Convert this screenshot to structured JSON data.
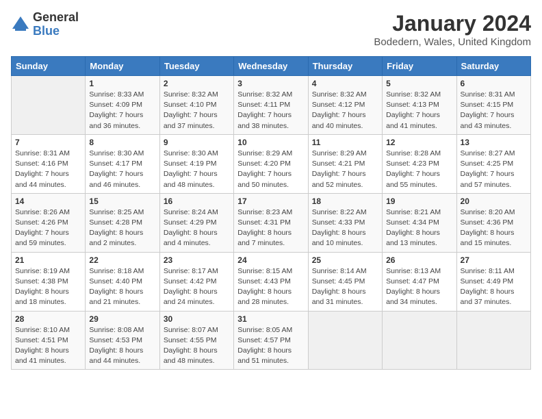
{
  "header": {
    "logo_general": "General",
    "logo_blue": "Blue",
    "month_title": "January 2024",
    "location": "Bodedern, Wales, United Kingdom"
  },
  "days_of_week": [
    "Sunday",
    "Monday",
    "Tuesday",
    "Wednesday",
    "Thursday",
    "Friday",
    "Saturday"
  ],
  "weeks": [
    [
      {
        "day": "",
        "sunrise": "",
        "sunset": "",
        "daylight": "",
        "empty": true
      },
      {
        "day": "1",
        "sunrise": "Sunrise: 8:33 AM",
        "sunset": "Sunset: 4:09 PM",
        "daylight": "Daylight: 7 hours and 36 minutes."
      },
      {
        "day": "2",
        "sunrise": "Sunrise: 8:32 AM",
        "sunset": "Sunset: 4:10 PM",
        "daylight": "Daylight: 7 hours and 37 minutes."
      },
      {
        "day": "3",
        "sunrise": "Sunrise: 8:32 AM",
        "sunset": "Sunset: 4:11 PM",
        "daylight": "Daylight: 7 hours and 38 minutes."
      },
      {
        "day": "4",
        "sunrise": "Sunrise: 8:32 AM",
        "sunset": "Sunset: 4:12 PM",
        "daylight": "Daylight: 7 hours and 40 minutes."
      },
      {
        "day": "5",
        "sunrise": "Sunrise: 8:32 AM",
        "sunset": "Sunset: 4:13 PM",
        "daylight": "Daylight: 7 hours and 41 minutes."
      },
      {
        "day": "6",
        "sunrise": "Sunrise: 8:31 AM",
        "sunset": "Sunset: 4:15 PM",
        "daylight": "Daylight: 7 hours and 43 minutes."
      }
    ],
    [
      {
        "day": "7",
        "sunrise": "Sunrise: 8:31 AM",
        "sunset": "Sunset: 4:16 PM",
        "daylight": "Daylight: 7 hours and 44 minutes."
      },
      {
        "day": "8",
        "sunrise": "Sunrise: 8:30 AM",
        "sunset": "Sunset: 4:17 PM",
        "daylight": "Daylight: 7 hours and 46 minutes."
      },
      {
        "day": "9",
        "sunrise": "Sunrise: 8:30 AM",
        "sunset": "Sunset: 4:19 PM",
        "daylight": "Daylight: 7 hours and 48 minutes."
      },
      {
        "day": "10",
        "sunrise": "Sunrise: 8:29 AM",
        "sunset": "Sunset: 4:20 PM",
        "daylight": "Daylight: 7 hours and 50 minutes."
      },
      {
        "day": "11",
        "sunrise": "Sunrise: 8:29 AM",
        "sunset": "Sunset: 4:21 PM",
        "daylight": "Daylight: 7 hours and 52 minutes."
      },
      {
        "day": "12",
        "sunrise": "Sunrise: 8:28 AM",
        "sunset": "Sunset: 4:23 PM",
        "daylight": "Daylight: 7 hours and 55 minutes."
      },
      {
        "day": "13",
        "sunrise": "Sunrise: 8:27 AM",
        "sunset": "Sunset: 4:25 PM",
        "daylight": "Daylight: 7 hours and 57 minutes."
      }
    ],
    [
      {
        "day": "14",
        "sunrise": "Sunrise: 8:26 AM",
        "sunset": "Sunset: 4:26 PM",
        "daylight": "Daylight: 7 hours and 59 minutes."
      },
      {
        "day": "15",
        "sunrise": "Sunrise: 8:25 AM",
        "sunset": "Sunset: 4:28 PM",
        "daylight": "Daylight: 8 hours and 2 minutes."
      },
      {
        "day": "16",
        "sunrise": "Sunrise: 8:24 AM",
        "sunset": "Sunset: 4:29 PM",
        "daylight": "Daylight: 8 hours and 4 minutes."
      },
      {
        "day": "17",
        "sunrise": "Sunrise: 8:23 AM",
        "sunset": "Sunset: 4:31 PM",
        "daylight": "Daylight: 8 hours and 7 minutes."
      },
      {
        "day": "18",
        "sunrise": "Sunrise: 8:22 AM",
        "sunset": "Sunset: 4:33 PM",
        "daylight": "Daylight: 8 hours and 10 minutes."
      },
      {
        "day": "19",
        "sunrise": "Sunrise: 8:21 AM",
        "sunset": "Sunset: 4:34 PM",
        "daylight": "Daylight: 8 hours and 13 minutes."
      },
      {
        "day": "20",
        "sunrise": "Sunrise: 8:20 AM",
        "sunset": "Sunset: 4:36 PM",
        "daylight": "Daylight: 8 hours and 15 minutes."
      }
    ],
    [
      {
        "day": "21",
        "sunrise": "Sunrise: 8:19 AM",
        "sunset": "Sunset: 4:38 PM",
        "daylight": "Daylight: 8 hours and 18 minutes."
      },
      {
        "day": "22",
        "sunrise": "Sunrise: 8:18 AM",
        "sunset": "Sunset: 4:40 PM",
        "daylight": "Daylight: 8 hours and 21 minutes."
      },
      {
        "day": "23",
        "sunrise": "Sunrise: 8:17 AM",
        "sunset": "Sunset: 4:42 PM",
        "daylight": "Daylight: 8 hours and 24 minutes."
      },
      {
        "day": "24",
        "sunrise": "Sunrise: 8:15 AM",
        "sunset": "Sunset: 4:43 PM",
        "daylight": "Daylight: 8 hours and 28 minutes."
      },
      {
        "day": "25",
        "sunrise": "Sunrise: 8:14 AM",
        "sunset": "Sunset: 4:45 PM",
        "daylight": "Daylight: 8 hours and 31 minutes."
      },
      {
        "day": "26",
        "sunrise": "Sunrise: 8:13 AM",
        "sunset": "Sunset: 4:47 PM",
        "daylight": "Daylight: 8 hours and 34 minutes."
      },
      {
        "day": "27",
        "sunrise": "Sunrise: 8:11 AM",
        "sunset": "Sunset: 4:49 PM",
        "daylight": "Daylight: 8 hours and 37 minutes."
      }
    ],
    [
      {
        "day": "28",
        "sunrise": "Sunrise: 8:10 AM",
        "sunset": "Sunset: 4:51 PM",
        "daylight": "Daylight: 8 hours and 41 minutes."
      },
      {
        "day": "29",
        "sunrise": "Sunrise: 8:08 AM",
        "sunset": "Sunset: 4:53 PM",
        "daylight": "Daylight: 8 hours and 44 minutes."
      },
      {
        "day": "30",
        "sunrise": "Sunrise: 8:07 AM",
        "sunset": "Sunset: 4:55 PM",
        "daylight": "Daylight: 8 hours and 48 minutes."
      },
      {
        "day": "31",
        "sunrise": "Sunrise: 8:05 AM",
        "sunset": "Sunset: 4:57 PM",
        "daylight": "Daylight: 8 hours and 51 minutes."
      },
      {
        "day": "",
        "sunrise": "",
        "sunset": "",
        "daylight": "",
        "empty": true
      },
      {
        "day": "",
        "sunrise": "",
        "sunset": "",
        "daylight": "",
        "empty": true
      },
      {
        "day": "",
        "sunrise": "",
        "sunset": "",
        "daylight": "",
        "empty": true
      }
    ]
  ]
}
